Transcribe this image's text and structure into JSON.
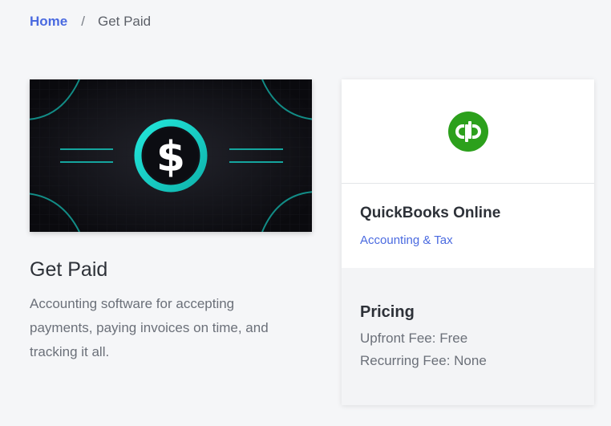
{
  "breadcrumb": {
    "home_label": "Home",
    "separator": "/",
    "current_label": "Get Paid"
  },
  "hero": {
    "icon": "dollar-sign-icon",
    "accent_color": "#17d6cc",
    "background_color": "#0d0d12"
  },
  "app": {
    "title": "Get Paid",
    "description": "Accounting software for accepting payments, paying invoices on time, and tracking it all."
  },
  "sidebar_card": {
    "logo": {
      "icon": "quickbooks-logo-icon",
      "color": "#2ca01c"
    },
    "product_name": "QuickBooks Online",
    "category_label": "Accounting & Tax",
    "pricing": {
      "heading": "Pricing",
      "upfront_fee": "Upfront Fee: Free",
      "recurring_fee": "Recurring Fee: None"
    }
  },
  "colors": {
    "link": "#4a6ae0",
    "page_background": "#f5f6f8"
  }
}
